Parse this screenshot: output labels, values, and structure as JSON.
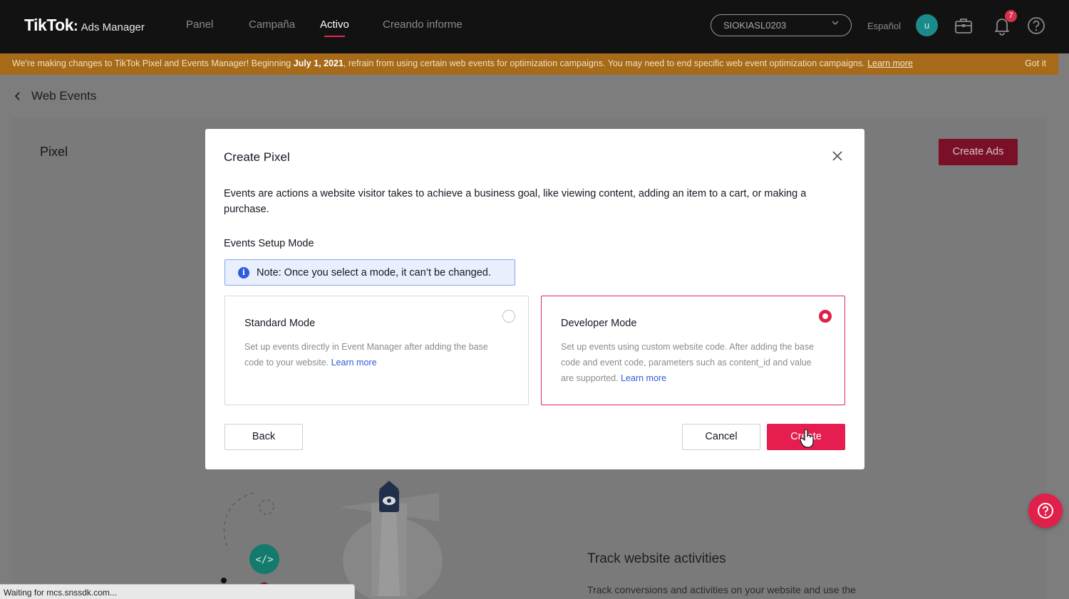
{
  "nav": {
    "logo_main": "TikTok",
    "logo_colon": ":",
    "logo_sub": "Ads Manager",
    "links": [
      "Panel",
      "Campaña",
      "Activo",
      "Creando informe"
    ],
    "active": "Activo",
    "account": "SIOKIASL0203",
    "language": "Español",
    "avatar_letter": "u",
    "notification_count": "7",
    "icons": [
      "chevron-down-icon",
      "briefcase-icon",
      "bell-icon",
      "help-icon"
    ]
  },
  "banner": {
    "text_before": "We're making changes to TikTok Pixel and Events Manager! Beginning ",
    "date": "July 1, 2021",
    "text_after": ", refrain from using certain web events for optimization campaigns. You may need to end specific web event optimization campaigns. ",
    "learn_more": "Learn more",
    "dismiss": "Got it",
    "color": "#a66a18"
  },
  "page": {
    "breadcrumb": "Web Events",
    "card_title": "Pixel",
    "create_ads": "Create Ads",
    "track_title": "Track website activities",
    "track_desc": "Track conversions and activities on your website and use the"
  },
  "modal": {
    "title": "Create Pixel",
    "description": "Events are actions a website visitor takes to achieve a business goal, like viewing content, adding an item to a cart, or making a purchase.",
    "section_label": "Events Setup Mode",
    "note": "Note: Once you select a mode, it can’t be changed.",
    "modes": [
      {
        "title": "Standard Mode",
        "description": "Set up events directly in Event Manager after adding the base code to your website. ",
        "link": "Learn more",
        "selected": false
      },
      {
        "title": "Developer Mode",
        "description": "Set up events using custom website code. After adding the base code and event code, parameters such as content_id and value are supported. ",
        "link": "Learn more",
        "selected": true
      }
    ],
    "back": "Back",
    "cancel": "Cancel",
    "create": "Create",
    "accent_color": "#e51e4f"
  },
  "statusbar": "Waiting for mcs.snssdk.com..."
}
